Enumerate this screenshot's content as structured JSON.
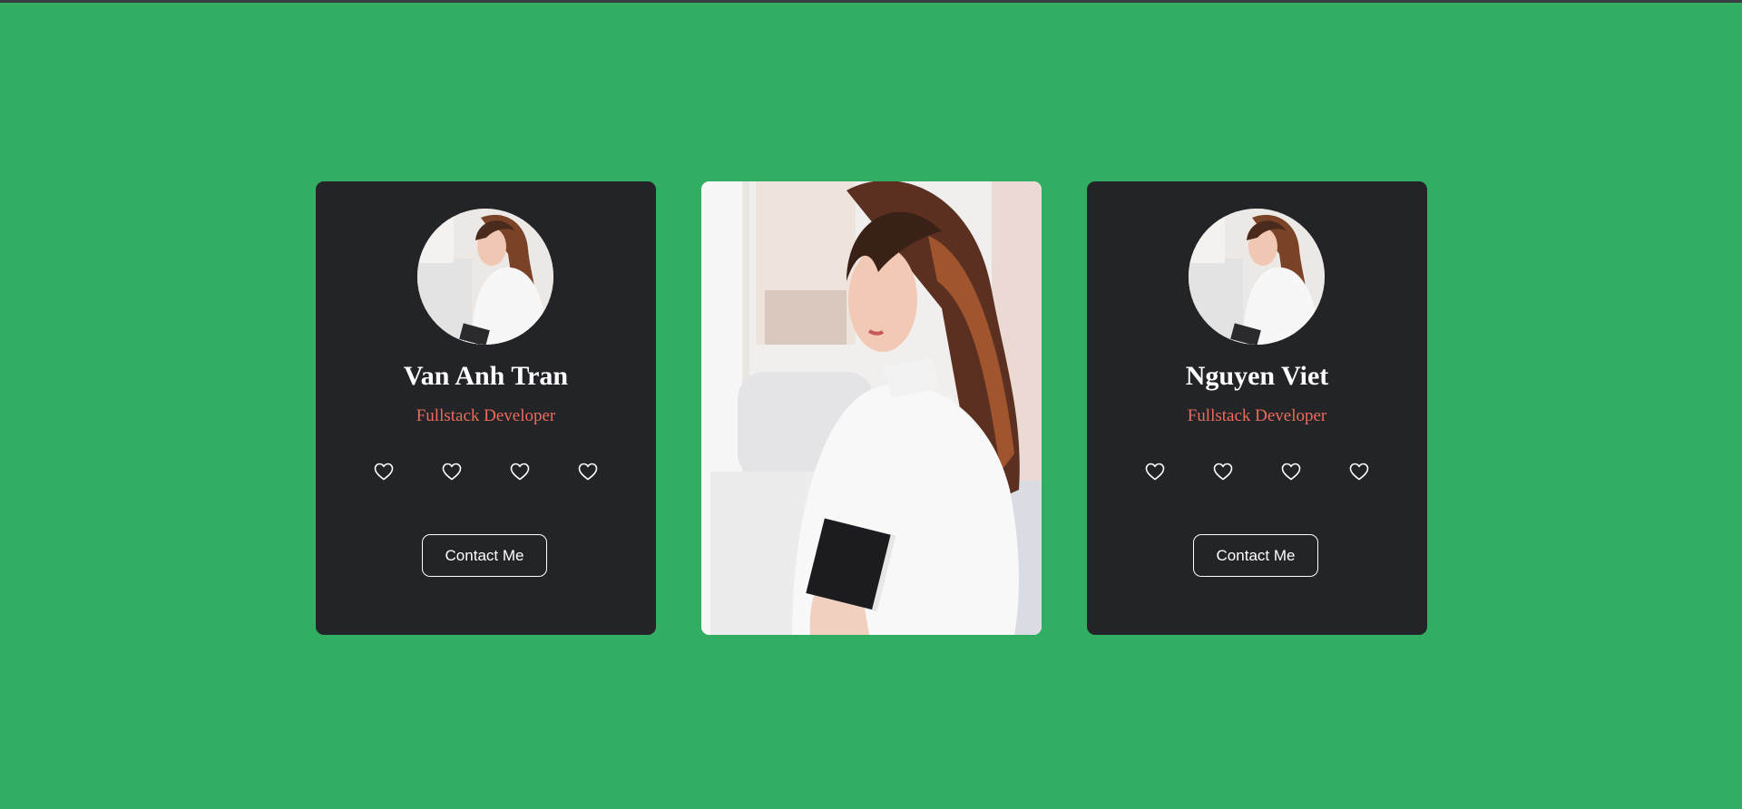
{
  "cards": [
    {
      "name": "Van Anh Tran",
      "role": "Fullstack Developer",
      "button_label": "Contact Me",
      "social_icons": [
        "heart-icon",
        "heart-icon",
        "heart-icon",
        "heart-icon"
      ]
    },
    {
      "type": "photo"
    },
    {
      "name": "Nguyen Viet",
      "role": "Fullstack Developer",
      "button_label": "Contact Me",
      "social_icons": [
        "heart-icon",
        "heart-icon",
        "heart-icon",
        "heart-icon"
      ]
    }
  ],
  "colors": {
    "background": "#31ae61",
    "card": "#232427",
    "accent": "#ee6a5b",
    "text": "#ffffff"
  }
}
